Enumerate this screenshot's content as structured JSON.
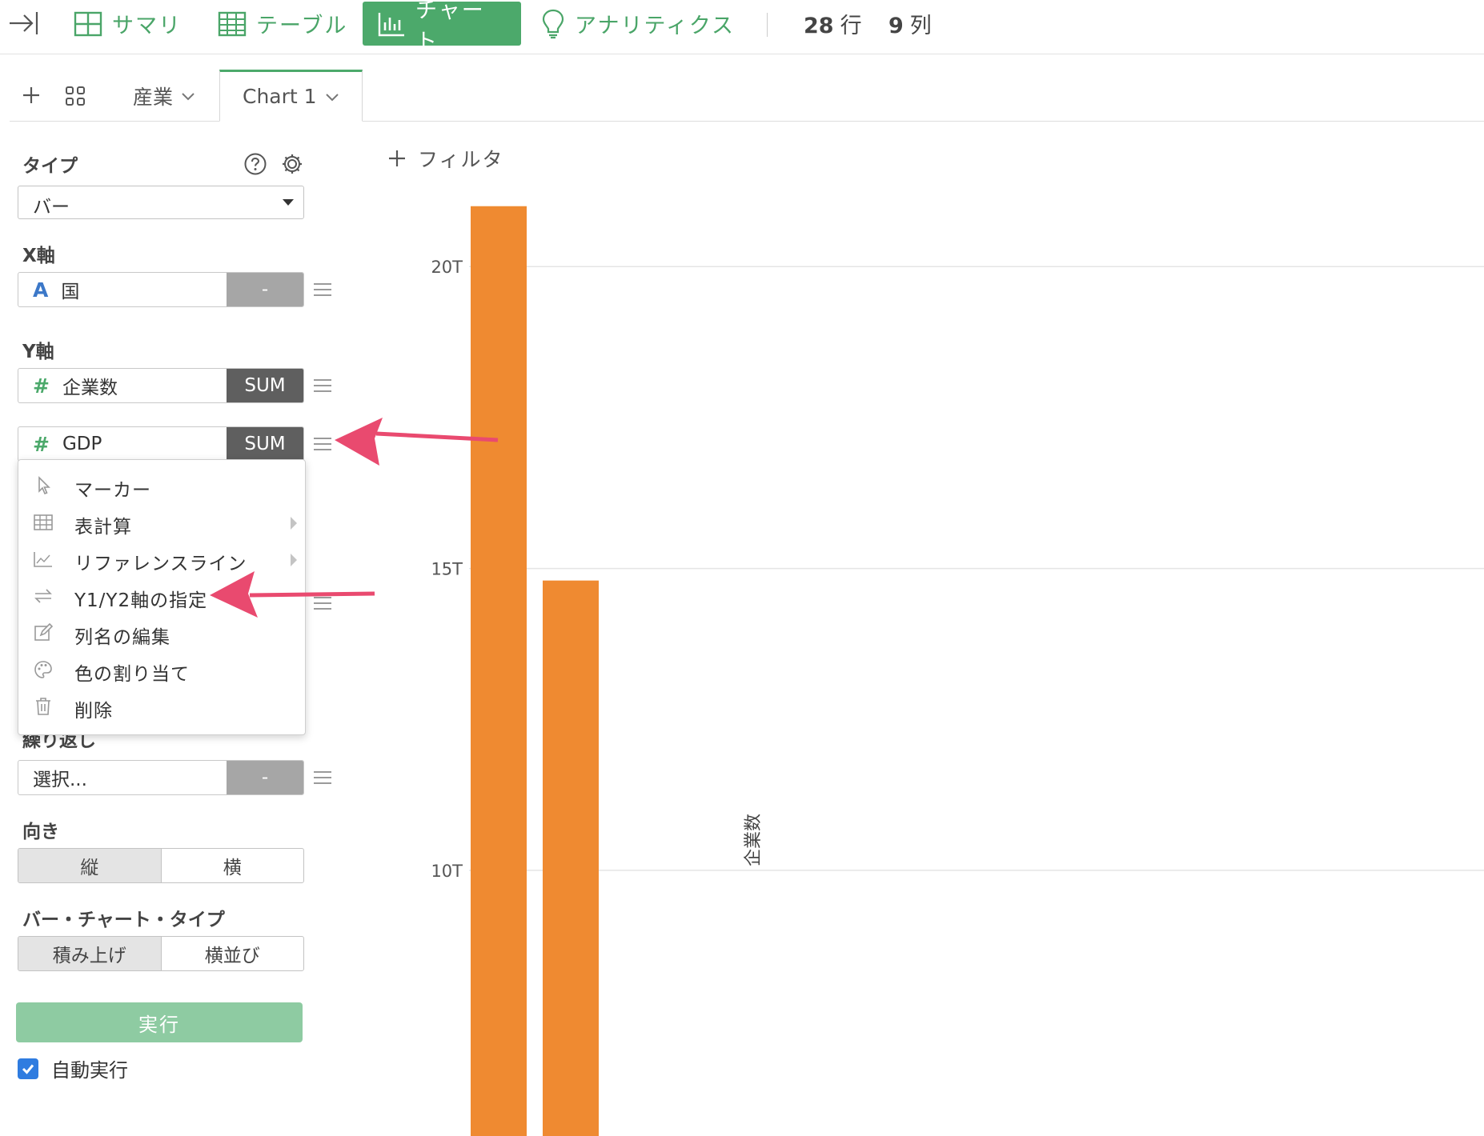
{
  "toolbar": {
    "tabs": [
      {
        "label": "サマリ",
        "icon": "summary-grid-icon"
      },
      {
        "label": "テーブル",
        "icon": "table-icon"
      },
      {
        "label": "チャート",
        "icon": "bar-chart-icon",
        "active": true
      },
      {
        "label": "アナリティクス",
        "icon": "lightbulb-icon"
      }
    ],
    "rows_count": "28",
    "rows_unit": "行",
    "cols_count": "9",
    "cols_unit": "列"
  },
  "chart_tabs": {
    "group_label": "産業",
    "active_label": "Chart 1"
  },
  "panel": {
    "type_label": "タイプ",
    "type_value": "バー",
    "x_axis_label": "X軸",
    "x_field": {
      "type_icon": "A",
      "name": "国",
      "agg": "-"
    },
    "y_axis_label": "Y軸",
    "y_fields": [
      {
        "type_icon": "#",
        "name": "企業数",
        "agg": "SUM"
      },
      {
        "type_icon": "#",
        "name": "GDP",
        "agg": "SUM"
      }
    ],
    "repeat_label": "繰り返し",
    "repeat_value": "選択...",
    "repeat_agg": "-",
    "orientation_label": "向き",
    "orientation_options": [
      "縦",
      "横"
    ],
    "bar_type_label": "バー・チャート・タイプ",
    "bar_type_options": [
      "積み上げ",
      "横並び"
    ],
    "run_label": "実行",
    "auto_run_label": "自動実行",
    "auto_run_checked": true
  },
  "menu": {
    "items": [
      {
        "label": "マーカー",
        "icon": "cursor-icon",
        "submenu": false
      },
      {
        "label": "表計算",
        "icon": "table-calc-icon",
        "submenu": true
      },
      {
        "label": "リファレンスライン",
        "icon": "reference-line-icon",
        "submenu": true
      },
      {
        "label": "Y1/Y2軸の指定",
        "icon": "swap-icon",
        "submenu": false
      },
      {
        "label": "列名の編集",
        "icon": "edit-icon",
        "submenu": false
      },
      {
        "label": "色の割り当て",
        "icon": "palette-icon",
        "submenu": false
      },
      {
        "label": "削除",
        "icon": "trash-icon",
        "submenu": false
      }
    ]
  },
  "filter_label": "フィルタ",
  "colors": {
    "accent": "#4ca96b",
    "bar": "#ef8a31",
    "arrow": "#e94a6f"
  },
  "chart_data": {
    "type": "bar",
    "ylabel": "企業数",
    "yticks": [
      10,
      15,
      20
    ],
    "tick_labels": [
      "10T",
      "15T",
      "20T"
    ],
    "ylim_visible": [
      5.6,
      21.5
    ],
    "categories": [
      "",
      ""
    ],
    "values": [
      21.0,
      14.8
    ],
    "unit": "T"
  }
}
